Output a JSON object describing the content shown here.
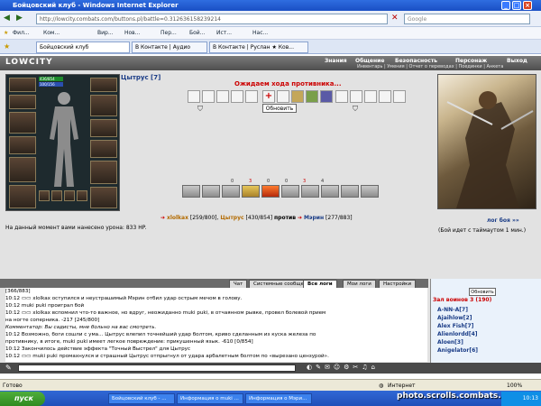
{
  "browser": {
    "window_title": "Бойцовский клуб - Windows Internet Explorer",
    "address": "http://lowcity.combats.com/buttons.pl/battle=0.312636158239214",
    "search_placeholder": "Google",
    "favorites": [
      "Фил...",
      "Ком...",
      "Вир...",
      "Нов...",
      "Пер...",
      "Бой...",
      "Ист...",
      "Нас..."
    ],
    "tabs": [
      "Бойцовский клуб",
      "В Контакте | Аудио",
      "В Контакте | Руслан ★ Ков..."
    ],
    "status_left": "Готово",
    "status_zone": "Интернет",
    "zoom": "100%"
  },
  "game": {
    "logo": "LOWCITY",
    "nav": [
      "Знания",
      "Общение",
      "Безопасность",
      "Персонаж",
      "Выход"
    ],
    "subnav": "Инвентарь | Умения | Отчет о переводах | Поединки | Анкета",
    "hp_label": "436/854",
    "mp_label": "100/156",
    "player_title": "Цытрус [7]",
    "wait_text": "Ожидаем хода противника...",
    "refresh_button": "Обновить",
    "counters": [
      "0",
      "3",
      "0",
      "0",
      "3",
      "4"
    ],
    "combatants": {
      "left": "xlolkax",
      "left_hp": "[259/800]",
      "mid": "Цытрус",
      "mid_hp": "[430/854]",
      "vs": "против",
      "right": "Мэрин",
      "right_hp": "[277/883]"
    },
    "damage_text": "На данный момент вами нанесено урона: 833 HP.",
    "log_link": "лог боя »»",
    "timeout_text": "(Бой идет с таймаутом 1 мин.)"
  },
  "chat": {
    "tabs": [
      "Чат",
      "Системные сообщения",
      "Все логи",
      "Мои логи",
      "Настройки"
    ],
    "active_tab": "Все логи",
    "lines": [
      "[366/883]",
      "10:12 ▭▭ xlolkax оступился и неустрашимый Мэрин отбил удар острым мечом в голову.",
      "10:12 muki puki проиграл бой",
      "10:12 ▭▭ xlolkax вспомнил что-то важное, но вдруг, неожиданно muki puki, в отчаянном рывке, провел болевой прием",
      "на ногте соперника. -217 [245/800]",
      "Комментатор: Вы садисты, мне больно на вас смотреть.",
      "10:12 Возможно, боги сошли с ума... Цытрус влепил точнейший удар болтом, криво сделанным из куска железа по",
      "противнику, в итоге, muki puki имеет легкое повреждение: прикушенный язык. -610 [0/854]",
      "10:12 Закончилось действие эффекта \"Точный Выстрел\" для Цытрус",
      "10:12 ▭▭ muki puki промахнулся и страшный Цытрус отпрыгнул от удара арбалетным болтом по «вырезано цензурой»."
    ]
  },
  "warriors": {
    "update_button": "Обновить",
    "title": "Зал воинов 3 (190)",
    "list": [
      "A-NN-A[7]",
      "Ajaihlow[2]",
      "Alex Fish[7]",
      "Alienlordd[4]",
      "Aloen[3]",
      "Anigelator[6]"
    ]
  },
  "taskbar": {
    "start": "пуск",
    "tasks": [
      "Бойцовский клуб - ...",
      "Информация о muki ...",
      "Информация о Мэри..."
    ],
    "clock": "10:13",
    "watermark": "photo.scrolls.combats.com"
  }
}
